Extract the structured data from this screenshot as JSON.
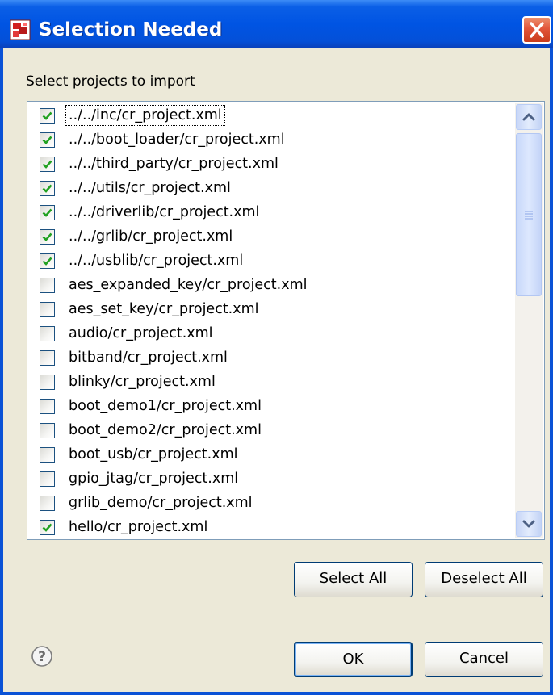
{
  "dialog": {
    "title": "Selection Needed",
    "prompt": "Select projects to import"
  },
  "projects": [
    {
      "label": "../../inc/cr_project.xml",
      "checked": true
    },
    {
      "label": "../../boot_loader/cr_project.xml",
      "checked": true
    },
    {
      "label": "../../third_party/cr_project.xml",
      "checked": true
    },
    {
      "label": "../../utils/cr_project.xml",
      "checked": true
    },
    {
      "label": "../../driverlib/cr_project.xml",
      "checked": true
    },
    {
      "label": "../../grlib/cr_project.xml",
      "checked": true
    },
    {
      "label": "../../usblib/cr_project.xml",
      "checked": true
    },
    {
      "label": "aes_expanded_key/cr_project.xml",
      "checked": false
    },
    {
      "label": "aes_set_key/cr_project.xml",
      "checked": false
    },
    {
      "label": "audio/cr_project.xml",
      "checked": false
    },
    {
      "label": "bitband/cr_project.xml",
      "checked": false
    },
    {
      "label": "blinky/cr_project.xml",
      "checked": false
    },
    {
      "label": "boot_demo1/cr_project.xml",
      "checked": false
    },
    {
      "label": "boot_demo2/cr_project.xml",
      "checked": false
    },
    {
      "label": "boot_usb/cr_project.xml",
      "checked": false
    },
    {
      "label": "gpio_jtag/cr_project.xml",
      "checked": false
    },
    {
      "label": "grlib_demo/cr_project.xml",
      "checked": false
    },
    {
      "label": "hello/cr_project.xml",
      "checked": true
    }
  ],
  "buttons": {
    "select_all": "Select All",
    "deselect_all": "Deselect All",
    "ok": "OK",
    "cancel": "Cancel"
  },
  "icons": {
    "app": "project-icon",
    "close": "close-icon",
    "help": "help-icon",
    "scroll_up": "chevron-up-icon",
    "scroll_down": "chevron-down-icon",
    "checkmark": "checkmark-icon"
  },
  "colors": {
    "titlebar": "#0054e3",
    "dialog_bg": "#ece9d8",
    "checkmark": "#21a121",
    "close_button": "#e2553a"
  }
}
